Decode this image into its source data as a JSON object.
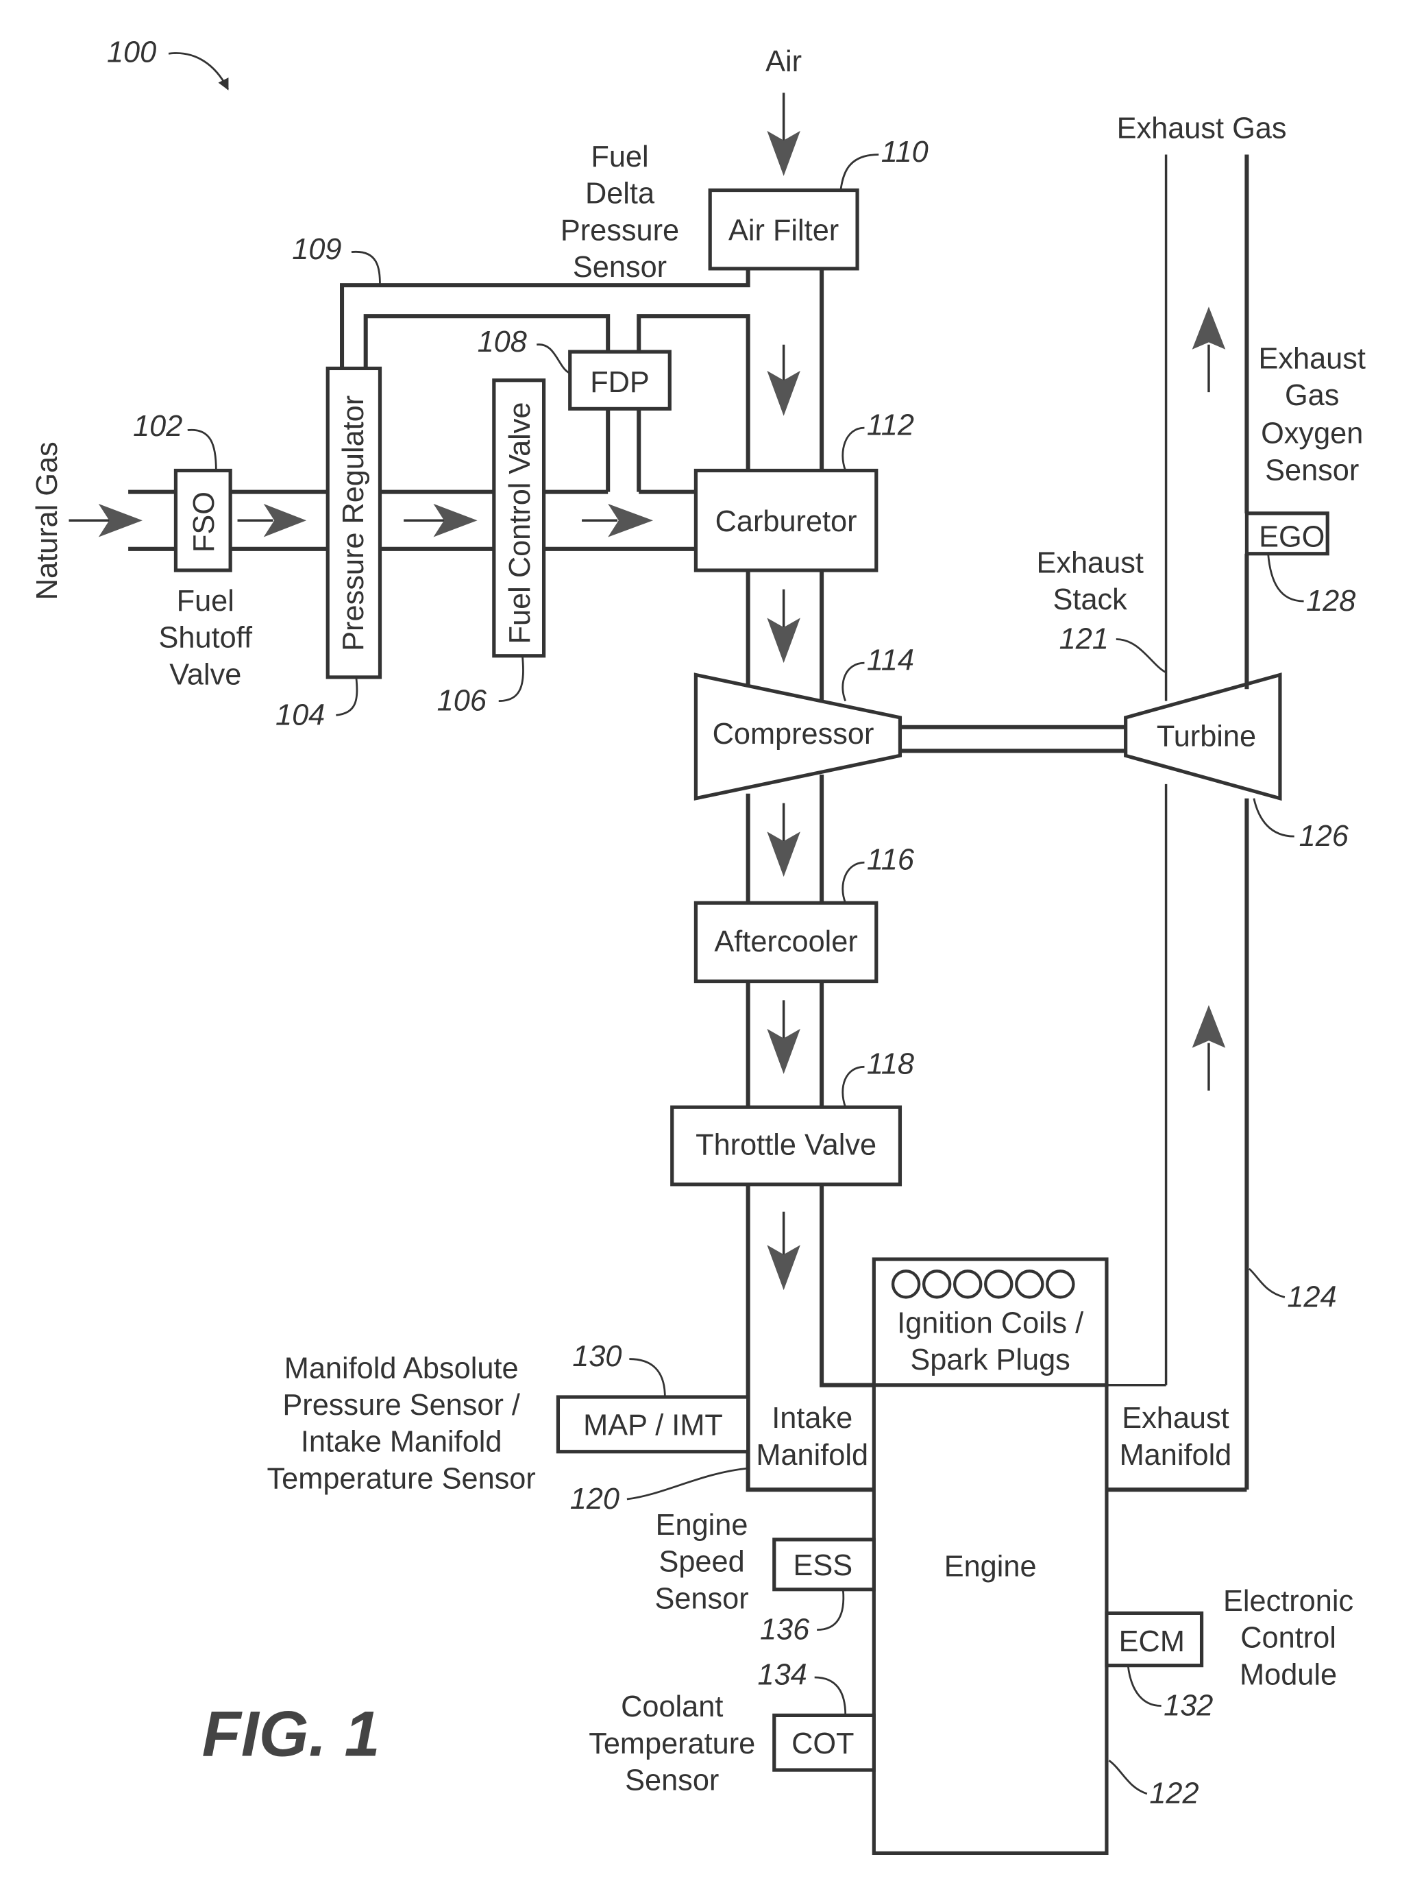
{
  "figure": {
    "title": "FIG. 1",
    "system_ref": "100"
  },
  "inputs": {
    "natural_gas": "Natural Gas",
    "air": "Air",
    "exhaust_gas": "Exhaust Gas"
  },
  "components": {
    "fso": {
      "abbr": "FSO",
      "name_lines": [
        "Fuel",
        "Shutoff",
        "Valve"
      ],
      "ref": "102"
    },
    "pressure_regulator": {
      "name": "Pressure Regulator",
      "ref": "104"
    },
    "fuel_control_valve": {
      "name": "Fuel Control Valve",
      "ref": "106"
    },
    "fdp": {
      "abbr": "FDP",
      "name_lines": [
        "Fuel",
        "Delta",
        "Pressure",
        "Sensor"
      ],
      "ref": "108"
    },
    "reference_line": {
      "ref": "109"
    },
    "air_filter": {
      "name": "Air Filter",
      "ref": "110"
    },
    "carburetor": {
      "name": "Carburetor",
      "ref": "112"
    },
    "compressor": {
      "name": "Compressor",
      "ref": "114"
    },
    "aftercooler": {
      "name": "Aftercooler",
      "ref": "116"
    },
    "throttle_valve": {
      "name": "Throttle Valve",
      "ref": "118"
    },
    "intake_manifold": {
      "name_lines": [
        "Intake",
        "Manifold"
      ],
      "ref": "120"
    },
    "exhaust_stack": {
      "name_lines": [
        "Exhaust",
        "Stack"
      ],
      "ref": "121"
    },
    "engine": {
      "name": "Engine",
      "ref": "122"
    },
    "ignition": {
      "name_lines": [
        "Ignition Coils /",
        "Spark Plugs"
      ],
      "coil_count": 6
    },
    "exhaust_manifold": {
      "name_lines": [
        "Exhaust",
        "Manifold"
      ],
      "ref": "124"
    },
    "turbine": {
      "name": "Turbine",
      "ref": "126"
    },
    "ego": {
      "abbr": "EGO",
      "name_lines": [
        "Exhaust",
        "Gas",
        "Oxygen",
        "Sensor"
      ],
      "ref": "128"
    },
    "map_imt": {
      "abbr": "MAP / IMT",
      "name_lines": [
        "Manifold Absolute",
        "Pressure Sensor /",
        "Intake Manifold",
        "Temperature Sensor"
      ],
      "ref": "130"
    },
    "ecm": {
      "abbr": "ECM",
      "name_lines": [
        "Electronic",
        "Control",
        "Module"
      ],
      "ref": "132"
    },
    "cot": {
      "abbr": "COT",
      "name_lines": [
        "Coolant",
        "Temperature",
        "Sensor"
      ],
      "ref": "134"
    },
    "ess": {
      "abbr": "ESS",
      "name_lines": [
        "Engine",
        "Speed",
        "Sensor"
      ],
      "ref": "136"
    }
  }
}
